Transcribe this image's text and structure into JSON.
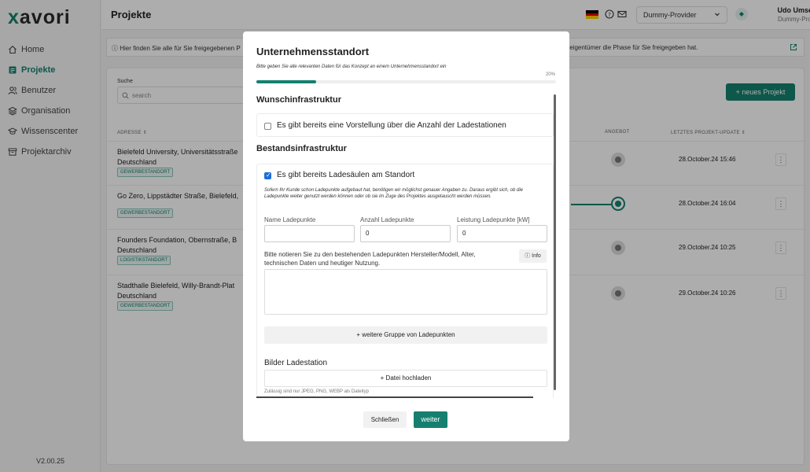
{
  "app": {
    "logo_x": "x",
    "logo_rest": "avori",
    "version": "V2.00.25",
    "accent_color": "#15806f"
  },
  "sidebar": {
    "items": [
      {
        "label": "Home",
        "icon": "home-icon",
        "active": false
      },
      {
        "label": "Projekte",
        "icon": "projects-icon",
        "active": true
      },
      {
        "label": "Benutzer",
        "icon": "users-icon",
        "active": false
      },
      {
        "label": "Organisation",
        "icon": "organisation-icon",
        "active": false
      },
      {
        "label": "Wissenscenter",
        "icon": "knowledge-icon",
        "active": false
      },
      {
        "label": "Projektarchiv",
        "icon": "archive-icon",
        "active": false
      }
    ]
  },
  "header": {
    "title": "Projekte",
    "provider": "Dummy-Provider",
    "user_name": "Udo Umsetzer",
    "user_role": "Dummy-Provider"
  },
  "infobar": {
    "left": "Hier finden Sie alle für Sie freigegebenen P",
    "right": "teigentümer die Phase für Sie freigegeben hat."
  },
  "projects": {
    "search_label": "Suche",
    "search_placeholder": "search",
    "new_button": "+ neues Projekt",
    "col_address": "ADRESSE",
    "col_offer": "ANGEBOT",
    "col_update": "LETZTES PROJEKT-UPDATE",
    "rows": [
      {
        "address": "Bielefeld University, Universitätsstraße",
        "address2": "Deutschland",
        "tag": "GEWERBESTANDORT",
        "date": "28.October.24 15:46",
        "active": false
      },
      {
        "address": "Go Zero, Lippstädter Straße, Bielefeld,",
        "address2": "",
        "tag": "GEWERBESTANDORT",
        "date": "28.October.24 16:04",
        "active": true
      },
      {
        "address": "Founders Foundation, Obernstraße, B",
        "address2": "Deutschland",
        "tag": "LOGISTIKSTANDORT",
        "date": "29.October.24 10:25",
        "active": false
      },
      {
        "address": "Stadthalle Bielefeld, Willy-Brandt-Plat",
        "address2": "Deutschland",
        "tag": "GEWERBESTANDORT",
        "date": "29.October.24 10:26",
        "active": false
      }
    ]
  },
  "modal": {
    "title": "Unternehmensstandort",
    "subtitle": "Bitte geben Sie alle relevanten Daten für das Konzept an einem Unternehmensstandort ein",
    "progress_label": "20%",
    "progress": 0.2,
    "section1_title": "Wunschinfrastruktur",
    "section1_check": "Es gibt bereits eine Vorstellung über die Anzahl der Ladestationen",
    "section1_checked": false,
    "section2_title": "Bestandsinfrastruktur",
    "section2_check": "Es gibt bereits Ladesäulen am Standort",
    "section2_checked": true,
    "section2_note": "Sofern Ihr Kunde schon Ladepunkte aufgebaut hat, benötigen wir möglichst genauer Angaben zu. Daraus ergibt sich, ob die Ladepunkte weiter genutzt werden können oder ob sie im Zuge des Projektes ausgetauscht werden müssen.",
    "field_name_label": "Name Ladepunkte",
    "field_name_value": "",
    "field_count_label": "Anzahl Ladepunkte",
    "field_count_value": "0",
    "field_power_label": "Leistung Ladepunkte [kW]",
    "field_power_value": "0",
    "question": "Bitte notieren Sie zu den bestehenden Ladepunkten Hersteller/Modell, Alter, technischen Daten und heutiger Nutzung.",
    "info_label": "Info",
    "add_group": "+ weitere Gruppe von Ladepunkten",
    "images_title": "Bilder Ladestation",
    "upload": "+ Datei hochladen",
    "upload_hint": "Zulässig sind nur JPEG, PNG, WEBP als Dateityp",
    "close": "Schließen",
    "next": "weiter"
  }
}
